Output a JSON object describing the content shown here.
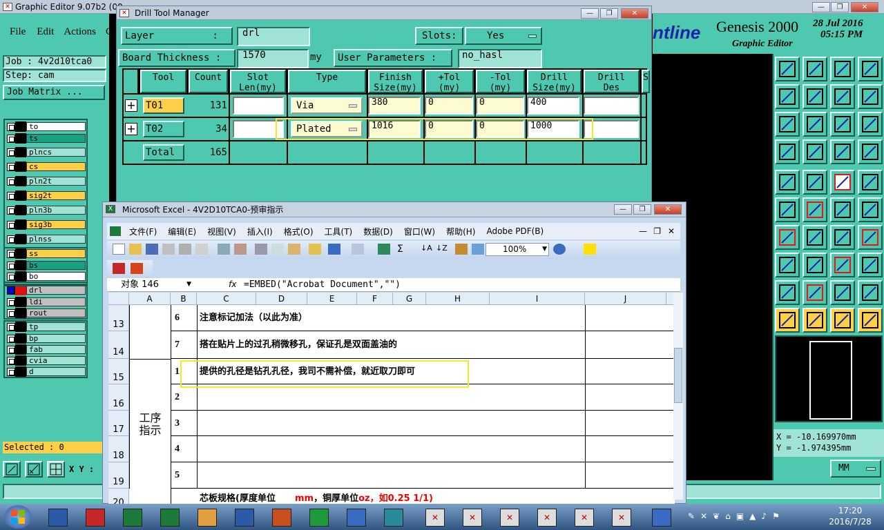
{
  "graphic_editor": {
    "title": "Graphic Editor 9.07b2 (00",
    "menu": [
      "File",
      "Edit",
      "Actions",
      "C"
    ],
    "job": "Job : 4v2d10tca0",
    "step": "Step: cam",
    "job_matrix": "Job Matrix ...",
    "layers": [
      {
        "name": "to",
        "color": "#ffffff"
      },
      {
        "name": "ts",
        "color": "#1aa184"
      },
      {
        "name": "plncs",
        "color": "#9fe3d6"
      },
      {
        "name": "cs",
        "color": "#ffcf47"
      },
      {
        "name": "pln2t",
        "color": "#9fe3d6"
      },
      {
        "name": "sig2t",
        "color": "#ffcf47"
      },
      {
        "name": "pln3b",
        "color": "#9fe3d6"
      },
      {
        "name": "sig3b",
        "color": "#ffcf47"
      },
      {
        "name": "plnss",
        "color": "#9fe3d6"
      },
      {
        "name": "ss",
        "color": "#ffcf47"
      },
      {
        "name": "bs",
        "color": "#1aa184"
      },
      {
        "name": "bo",
        "color": "#ffffff"
      },
      {
        "name": "drl",
        "color": "#c0c0c0"
      },
      {
        "name": "ldi",
        "color": "#c0c0c0"
      },
      {
        "name": "rout",
        "color": "#c0c0c0"
      },
      {
        "name": "tp",
        "color": "#9fe3d6"
      },
      {
        "name": "bp",
        "color": "#9fe3d6"
      },
      {
        "name": "fab",
        "color": "#9fe3d6"
      },
      {
        "name": "cvia",
        "color": "#9fe3d6"
      },
      {
        "name": "d",
        "color": "#9fe3d6"
      }
    ],
    "selected": "Selected : 0",
    "xy_label": "X Y :",
    "brand_partial": "ntline",
    "genesis": "Genesis 2000",
    "date": "28 Jul 2016",
    "time": "05:15 PM",
    "subtitle": "Graphic Editor",
    "coord_x": "X = -10.169970mm",
    "coord_y": "Y = -1.974395mm",
    "units": "MM"
  },
  "drill": {
    "title": "Drill Tool Manager",
    "layer_label": "Layer          :",
    "layer_value": "drl",
    "slots_label": "Slots:",
    "slots_value": "Yes",
    "thickness_label": "Board Thickness :",
    "thickness_value": "1570",
    "thickness_unit": "my",
    "user_params_label": "User Parameters :",
    "user_params_value": "no_hasl",
    "headers": [
      "Tool",
      "Count",
      "Slot\nLen(my)",
      "Type",
      "Finish\nSize(my)",
      "+Tol\n(my)",
      "-Tol\n(my)",
      "Drill\nSize(my)",
      "Drill\nDes",
      "S"
    ],
    "rows": [
      {
        "tool": "T01",
        "count": "131",
        "slot": "",
        "type": "Via",
        "finish": "380",
        "ptol": "0",
        "mtol": "0",
        "drill": "400",
        "des": ""
      },
      {
        "tool": "T02",
        "count": "34",
        "slot": "",
        "type": "Plated",
        "finish": "1016",
        "ptol": "0",
        "mtol": "0",
        "drill": "1000",
        "des": ""
      }
    ],
    "total_label": "Total",
    "total_count": "165"
  },
  "excel": {
    "title": "Microsoft Excel - 4V2D10TCA0-预审指示",
    "menu": [
      "文件(F)",
      "编辑(E)",
      "视图(V)",
      "插入(I)",
      "格式(O)",
      "工具(T)",
      "数据(D)",
      "窗口(W)",
      "帮助(H)",
      "Adobe PDF(B)"
    ],
    "zoom": "100%",
    "name_box": "对象 146",
    "fx": "fx",
    "formula": "=EMBED(\"Acrobat Document\",\"\")",
    "columns": [
      "A",
      "B",
      "C",
      "D",
      "E",
      "F",
      "G",
      "H",
      "I",
      "J"
    ],
    "rows": [
      {
        "num": "13",
        "b": "6",
        "c": "注意标记加法（以此为准）"
      },
      {
        "num": "14",
        "b": "7",
        "c": "搭在贴片上的过孔稍微移孔，保证孔是双面盖油的"
      },
      {
        "num": "15",
        "b": "1",
        "c": "提供的孔径是钻孔孔径，我司不需补偿，就近取刀即可"
      },
      {
        "num": "16",
        "b": "2",
        "c": ""
      },
      {
        "num": "17",
        "b": "3",
        "c": ""
      },
      {
        "num": "18",
        "b": "4",
        "c": ""
      },
      {
        "num": "19",
        "b": "5",
        "c": ""
      },
      {
        "num": "20",
        "b": "",
        "c": "芯板规格(厚度单位"
      }
    ],
    "merged_label": "工序\n指示",
    "row20_unit1": "mm",
    "row20_mid": "，铜厚单位",
    "row20_unit2": "oz",
    "row20_tail": "，如0.25 1/1)"
  },
  "taskbar": {
    "clock_time": "17:20",
    "clock_date": "2016/7/28"
  }
}
